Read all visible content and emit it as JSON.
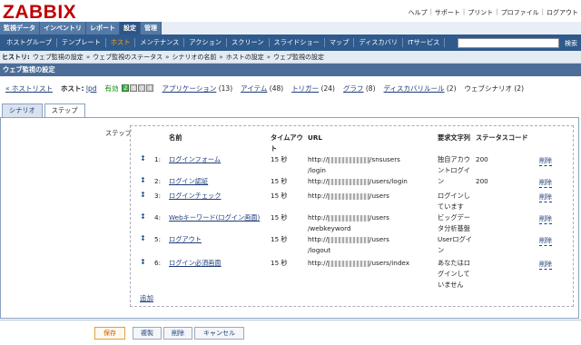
{
  "header": {
    "logo": "ZABBIX",
    "toplinks": [
      "ヘルプ",
      "サポート",
      "プリント",
      "プロファイル",
      "ログアウト"
    ]
  },
  "mainmenu": [
    "監視データ",
    "インベントリ",
    "レポート",
    "設定",
    "管理"
  ],
  "submenu": [
    "ホストグループ",
    "テンプレート",
    "ホスト",
    "メンテナンス",
    "アクション",
    "スクリーン",
    "スライドショー",
    "マップ",
    "ディスカバリ",
    "ITサービス"
  ],
  "search_button": "検索",
  "history": {
    "label": "ヒストリ:",
    "items": [
      "ウェブ監視の設定",
      "ウェブ監視のステータス",
      "シナリオの名前",
      "ホストの設定",
      "ウェブ監視の設定"
    ]
  },
  "page_title": "ウェブ監視の設定",
  "infobar": {
    "back": "« ホストリスト",
    "host_label": "ホスト:",
    "host_name": "lpd",
    "status": "有効",
    "box_letters": [
      "Z",
      "S",
      "J",
      "I"
    ],
    "links": [
      {
        "text": "アプリケーション",
        "count": "(13)"
      },
      {
        "text": "アイテム",
        "count": "(48)"
      },
      {
        "text": "トリガー",
        "count": "(24)"
      },
      {
        "text": "グラフ",
        "count": "(8)"
      },
      {
        "text": "ディスカバリルール",
        "count": "(2)"
      }
    ],
    "web": "ウェブシナリオ (2)"
  },
  "tabs": [
    "シナリオ",
    "ステップ"
  ],
  "steps_label": "ステップ",
  "columns": [
    "名前",
    "タイムアウト",
    "URL",
    "要求文字列",
    "ステータスコード"
  ],
  "steps": [
    {
      "num": "1:",
      "name": "ログインフォーム",
      "timeout": "15 秒",
      "url1": "/snsusers",
      "url2": "/login",
      "req": "独自アカウントログイン",
      "status": "200",
      "del": "削除"
    },
    {
      "num": "2:",
      "name": "ログイン認証",
      "timeout": "15 秒",
      "url1": "/users/login",
      "url2": "",
      "req": "",
      "status": "200",
      "del": "削除"
    },
    {
      "num": "3:",
      "name": "ログインチェック",
      "timeout": "15 秒",
      "url1": "/users",
      "url2": "",
      "req": "ログインしています",
      "status": "",
      "del": "削除"
    },
    {
      "num": "4:",
      "name": "Webキーワード(ログイン画面)",
      "timeout": "15 秒",
      "url1": "/users",
      "url2": "/webkeyword",
      "req": "ビッグデータ分析基盤",
      "status": "",
      "del": "削除"
    },
    {
      "num": "5:",
      "name": "ログアウト",
      "timeout": "15 秒",
      "url1": "/users",
      "url2": "/logout",
      "req": "Userログイン",
      "status": "",
      "del": "削除"
    },
    {
      "num": "6:",
      "name": "ログイン必須画面",
      "timeout": "15 秒",
      "url1": "/users/index",
      "url2": "",
      "req": "あなたはログインしていません",
      "status": "",
      "del": "削除"
    }
  ],
  "url_prefix": "http://",
  "add_label": "追加",
  "buttons": [
    "保存",
    "複製",
    "削除",
    "キャンセル"
  ]
}
